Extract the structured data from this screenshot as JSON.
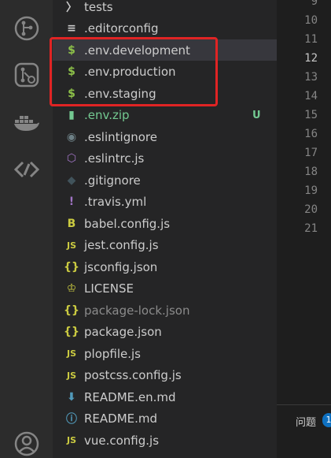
{
  "activity_bar": {
    "icons": [
      "git-graph-icon",
      "git-pull-request-icon",
      "docker-icon",
      "remote-explorer-icon",
      "account-icon"
    ]
  },
  "explorer": {
    "files": [
      {
        "label": "tests",
        "icon": "chevron-right-icon",
        "glyph": "〉",
        "color": "#cccccc"
      },
      {
        "label": ".editorconfig",
        "icon": "settings-lines-icon",
        "glyph": "≡",
        "color": "#cccccc"
      },
      {
        "label": ".env.development",
        "icon": "dollar-icon",
        "glyph": "$",
        "color": "#8dc149"
      },
      {
        "label": ".env.production",
        "icon": "dollar-icon",
        "glyph": "$",
        "color": "#8dc149"
      },
      {
        "label": ".env.staging",
        "icon": "dollar-icon",
        "glyph": "$",
        "color": "#8dc149"
      },
      {
        "label": ".env.zip",
        "icon": "zip-file-icon",
        "glyph": "▮",
        "color": "#73c991",
        "badge": "U"
      },
      {
        "label": ".eslintignore",
        "icon": "eslint-ignore-icon",
        "glyph": "◉",
        "color": "#6d8086"
      },
      {
        "label": ".eslintrc.js",
        "icon": "eslint-icon",
        "glyph": "⬡",
        "color": "#a074c4"
      },
      {
        "label": ".gitignore",
        "icon": "git-icon",
        "glyph": "◆",
        "color": "#41535b"
      },
      {
        "label": ".travis.yml",
        "icon": "travis-icon",
        "glyph": "!",
        "color": "#a074c4"
      },
      {
        "label": "babel.config.js",
        "icon": "babel-icon",
        "glyph": "B",
        "color": "#cbcb41"
      },
      {
        "label": "jest.config.js",
        "icon": "js-icon",
        "glyph": "JS",
        "color": "#cbcb41"
      },
      {
        "label": "jsconfig.json",
        "icon": "json-icon",
        "glyph": "{}",
        "color": "#cbcb41"
      },
      {
        "label": "LICENSE",
        "icon": "license-icon",
        "glyph": "♔",
        "color": "#cbcb41"
      },
      {
        "label": "package-lock.json",
        "icon": "json-icon",
        "glyph": "{}",
        "color": "#cbcb41",
        "muted": true
      },
      {
        "label": "package.json",
        "icon": "json-icon",
        "glyph": "{}",
        "color": "#cbcb41"
      },
      {
        "label": "plopfile.js",
        "icon": "js-icon",
        "glyph": "JS",
        "color": "#cbcb41"
      },
      {
        "label": "postcss.config.js",
        "icon": "js-icon",
        "glyph": "JS",
        "color": "#cbcb41"
      },
      {
        "label": "README.en.md",
        "icon": "download-arrow-icon",
        "glyph": "⬇",
        "color": "#519aba"
      },
      {
        "label": "README.md",
        "icon": "info-icon",
        "glyph": "ⓘ",
        "color": "#519aba"
      },
      {
        "label": "vue.config.js",
        "icon": "js-icon",
        "glyph": "JS",
        "color": "#cbcb41"
      }
    ]
  },
  "editor": {
    "line_numbers": [
      "9",
      "10",
      "11",
      "12",
      "13",
      "14",
      "15",
      "16",
      "17",
      "18",
      "19",
      "20",
      "21"
    ],
    "active_line": "12"
  },
  "panel": {
    "label": "问题",
    "count": "1"
  },
  "colors": {
    "highlight": "#e02424",
    "git_untracked": "#73c991",
    "selection": "#37373d"
  }
}
